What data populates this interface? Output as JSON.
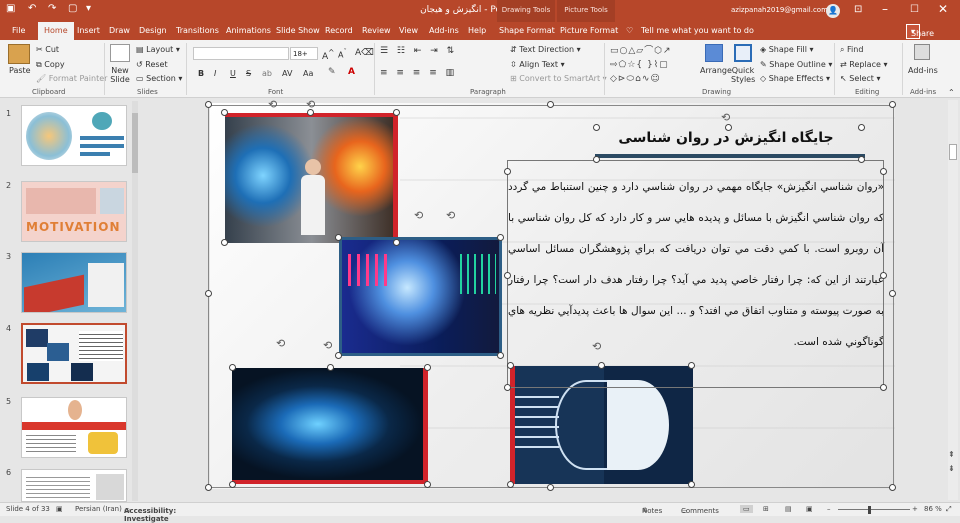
{
  "app": {
    "title": "انگیزش  و هیجان  -  PowerPoint",
    "account": "azizpanah2019@gmail.com",
    "drawing_tools": "Drawing Tools",
    "picture_tools": "Picture Tools",
    "brand_color": "#b7472a"
  },
  "tabs": [
    "File",
    "Home",
    "Insert",
    "Draw",
    "Design",
    "Transitions",
    "Animations",
    "Slide Show",
    "Record",
    "Review",
    "View",
    "Add-ins",
    "Help",
    "Shape Format",
    "Picture Format"
  ],
  "tell_me": "Tell me what you want to do",
  "share_label": "Share",
  "ribbon": {
    "clipboard": {
      "paste": "Paste",
      "cut": "Cut",
      "copy": "Copy",
      "format_painter": "Format Painter",
      "group": "Clipboard"
    },
    "slides": {
      "new_slide": "New Slide",
      "layout": "Layout",
      "reset": "Reset",
      "section": "Section",
      "group": "Slides"
    },
    "font": {
      "font_size": "18+",
      "bold": "B",
      "italic": "I",
      "underline": "U",
      "strike": "S",
      "shadow": "ab",
      "spacing": "AV",
      "case": "Aa",
      "group": "Font"
    },
    "paragraph": {
      "text_direction": "Text Direction",
      "align_text": "Align Text",
      "convert_smartart": "Convert to SmartArt",
      "group": "Paragraph"
    },
    "drawing": {
      "arrange": "Arrange",
      "quick_styles": "Quick Styles",
      "shape_fill": "Shape Fill",
      "shape_outline": "Shape Outline",
      "shape_effects": "Shape Effects",
      "group": "Drawing"
    },
    "editing": {
      "find": "Find",
      "replace": "Replace",
      "select": "Select",
      "group": "Editing"
    },
    "addins": {
      "label": "Add-ins",
      "group": "Add-ins"
    }
  },
  "thumbnails": [
    {
      "num": "1"
    },
    {
      "num": "2"
    },
    {
      "num": "3"
    },
    {
      "num": "4"
    },
    {
      "num": "5"
    },
    {
      "num": "6"
    }
  ],
  "thumb_text": {
    "motivation": "MOTIVATION"
  },
  "slide": {
    "title": "جایگاه انگیزش در روان شناسی",
    "body": "«روان شناسي انگيزش» جايگاه مهمي در روان شناسي دارد و چنين استنباط مي گردد كه روان شناسي انگيزش با مسائل و پديده هايي سر و كار دارد كه كل روان شناسي با آن روبرو است. با كمي دقت مي توان دريافت كه براي پژوهشگران مسائل اساسي عبارتند از اين كه: چرا رفتار خاصي پديد مي آيد؟ چرا رفتار هدف دار است؟ چرا رفتار به صورت پيوسته و متناوب اتفاق مي افتد؟ و ... اين سوال ها باعث پديدآيي نظريه هاي گوناگوني شده است."
  },
  "status": {
    "slide_of": "Slide 4 of 33",
    "language": "Persian (Iran)",
    "accessibility": "Accessibility: Investigate",
    "notes": "Notes",
    "comments": "Comments",
    "zoom": "86 %"
  }
}
